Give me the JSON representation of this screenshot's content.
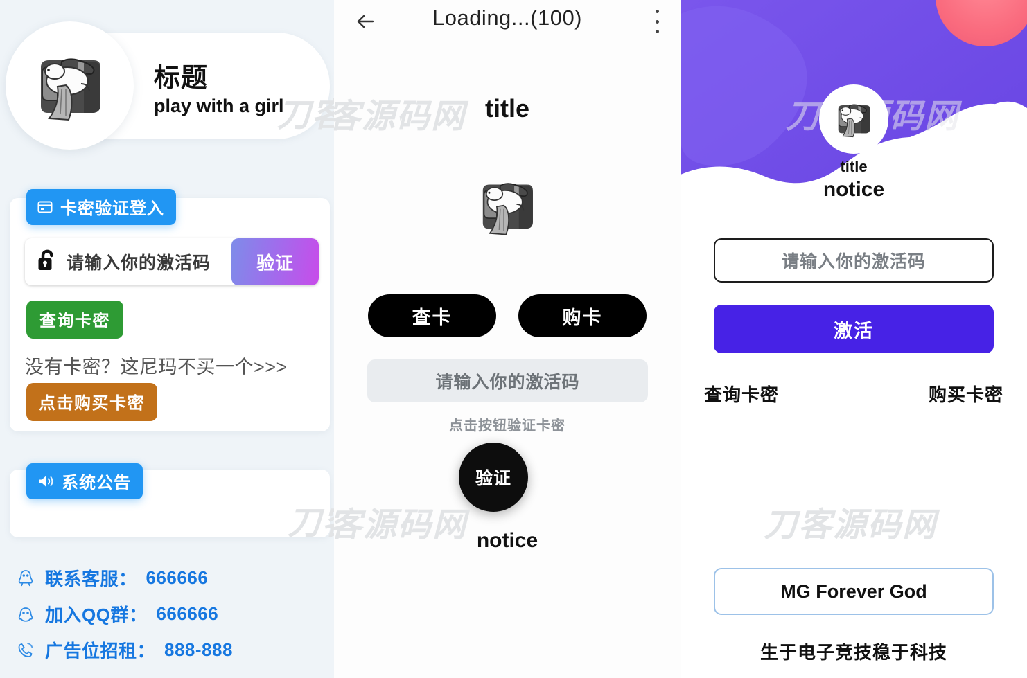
{
  "watermark": {
    "text": "刀客源码网"
  },
  "left_panel": {
    "header": {
      "title_cn": "标题",
      "title_en": "play with a girl",
      "logo_icon": "bear-on-armchair-logo"
    },
    "login_card": {
      "badge_label": "卡密验证登入",
      "badge_icon": "card-icon",
      "lock_icon": "unlock-icon",
      "input_placeholder": "请输入你的激活码",
      "verify_label": "验证",
      "query_label": "查询卡密",
      "promo_text": "没有卡密？这尼玛不买一个>>>",
      "buy_label": "点击购买卡密"
    },
    "notice_card": {
      "badge_label": "系统公告",
      "badge_icon": "speaker-icon",
      "body": ""
    },
    "contacts": [
      {
        "icon": "qq-penguin-icon",
        "label": "联系客服：",
        "value": "666666"
      },
      {
        "icon": "qq-group-icon",
        "label": "加入QQ群：",
        "value": "666666"
      },
      {
        "icon": "phone-icon",
        "label": "广告位招租：",
        "value": "888-888"
      }
    ]
  },
  "mid_panel": {
    "topbar": {
      "back_icon": "back-arrow-icon",
      "title": "Loading...(100)",
      "menu_icon": "kebab-menu-icon"
    },
    "title": "title",
    "logo_icon": "bear-on-armchair-logo",
    "buttons": [
      {
        "label": "查卡"
      },
      {
        "label": "购卡"
      }
    ],
    "input_placeholder": "请输入你的激活码",
    "hint": "点击按钮验证卡密",
    "verify_label": "验证",
    "notice": "notice"
  },
  "right_panel": {
    "hero": {
      "logo_icon": "bear-on-armchair-logo",
      "title": "title",
      "notice": "notice",
      "bg_purple": "#6f4ce8",
      "bg_purple_dark": "#5a3fd6",
      "bg_pink": "#fa6b7e"
    },
    "input_placeholder": "请输入你的激活码",
    "activate_label": "激活",
    "activate_color": "#4722e6",
    "links": [
      {
        "label": "查询卡密"
      },
      {
        "label": "购买卡密"
      }
    ],
    "footer_box": "MG Forever God",
    "slogan": "生于电子竞技稳于科技"
  }
}
